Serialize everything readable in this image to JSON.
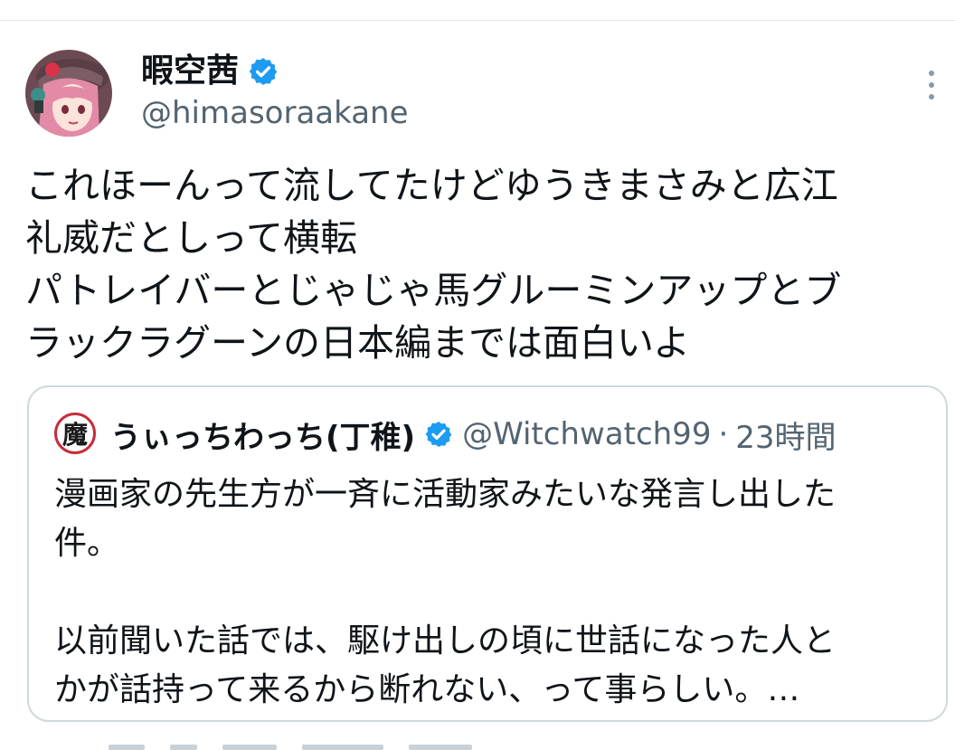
{
  "post": {
    "display_name": "暇空茜",
    "handle": "@himasoraakane",
    "verified": true,
    "text_lines": [
      "これほーんって流してたけどゆうきまさみと広江",
      "礼威だとしって横転",
      "パトレイバーとじゃじゃ馬グルーミンアップとブ",
      "ラックラグーンの日本編までは面白いよ"
    ],
    "avatar_icon": "anime-girl-avatar-icon",
    "more_icon": "more-vertical-icon"
  },
  "quote": {
    "avatar_glyph": "魔",
    "display_name": "うぃっちわっち(丁稚)",
    "verified": true,
    "handle": "@Witchwatch99",
    "separator": "·",
    "time": "23時間",
    "text_lines": [
      "漫画家の先生方が一斉に活動家みたいな発言し出した",
      "件。",
      "",
      "以前聞いた話では、駆け出しの頃に世話になった人と",
      "かが話持って来るから断れない、って事らしい。…"
    ]
  },
  "colors": {
    "verified_blue": "#1d9bf0",
    "secondary_text": "#536471",
    "border": "#cfd9de"
  }
}
